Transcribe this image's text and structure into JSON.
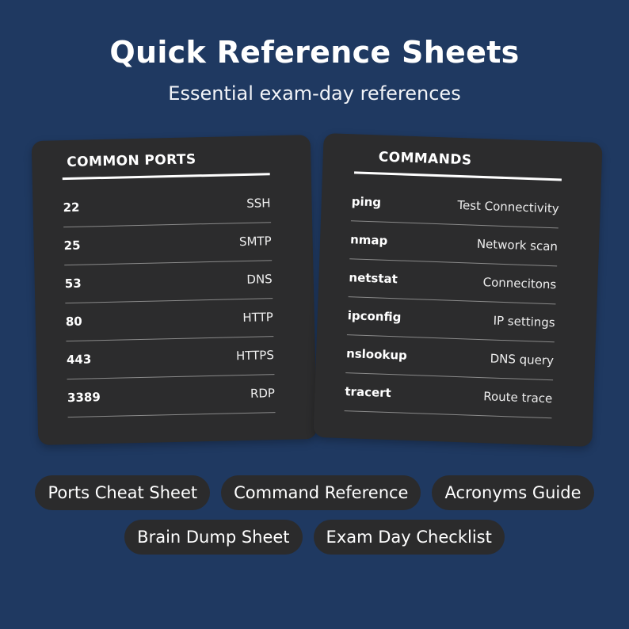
{
  "header": {
    "title": "Quick Reference Sheets",
    "subtitle": "Essential exam-day references"
  },
  "ports_card": {
    "heading": "COMMON PORTS",
    "rows": [
      {
        "key": "22",
        "value": "SSH"
      },
      {
        "key": "25",
        "value": "SMTP"
      },
      {
        "key": "53",
        "value": "DNS"
      },
      {
        "key": "80",
        "value": "HTTP"
      },
      {
        "key": "443",
        "value": "HTTPS"
      },
      {
        "key": "3389",
        "value": "RDP"
      }
    ]
  },
  "commands_card": {
    "heading": "COMMANDS",
    "rows": [
      {
        "key": "ping",
        "value": "Test Connectivity"
      },
      {
        "key": "nmap",
        "value": "Network scan"
      },
      {
        "key": "netstat",
        "value": "Connecitons"
      },
      {
        "key": "ipconfig",
        "value": "IP settings"
      },
      {
        "key": "nslookup",
        "value": "DNS query"
      },
      {
        "key": "tracert",
        "value": "Route trace"
      }
    ]
  },
  "tags": {
    "row1": [
      "Ports Cheat Sheet",
      "Command Reference",
      "Acronyms Guide"
    ],
    "row2": [
      "Brain Dump Sheet",
      "Exam Day Checklist"
    ]
  },
  "colors": {
    "background": "#1f3961",
    "card": "#2c2c2d",
    "pill": "#2b2b2c",
    "text": "#ffffff"
  }
}
